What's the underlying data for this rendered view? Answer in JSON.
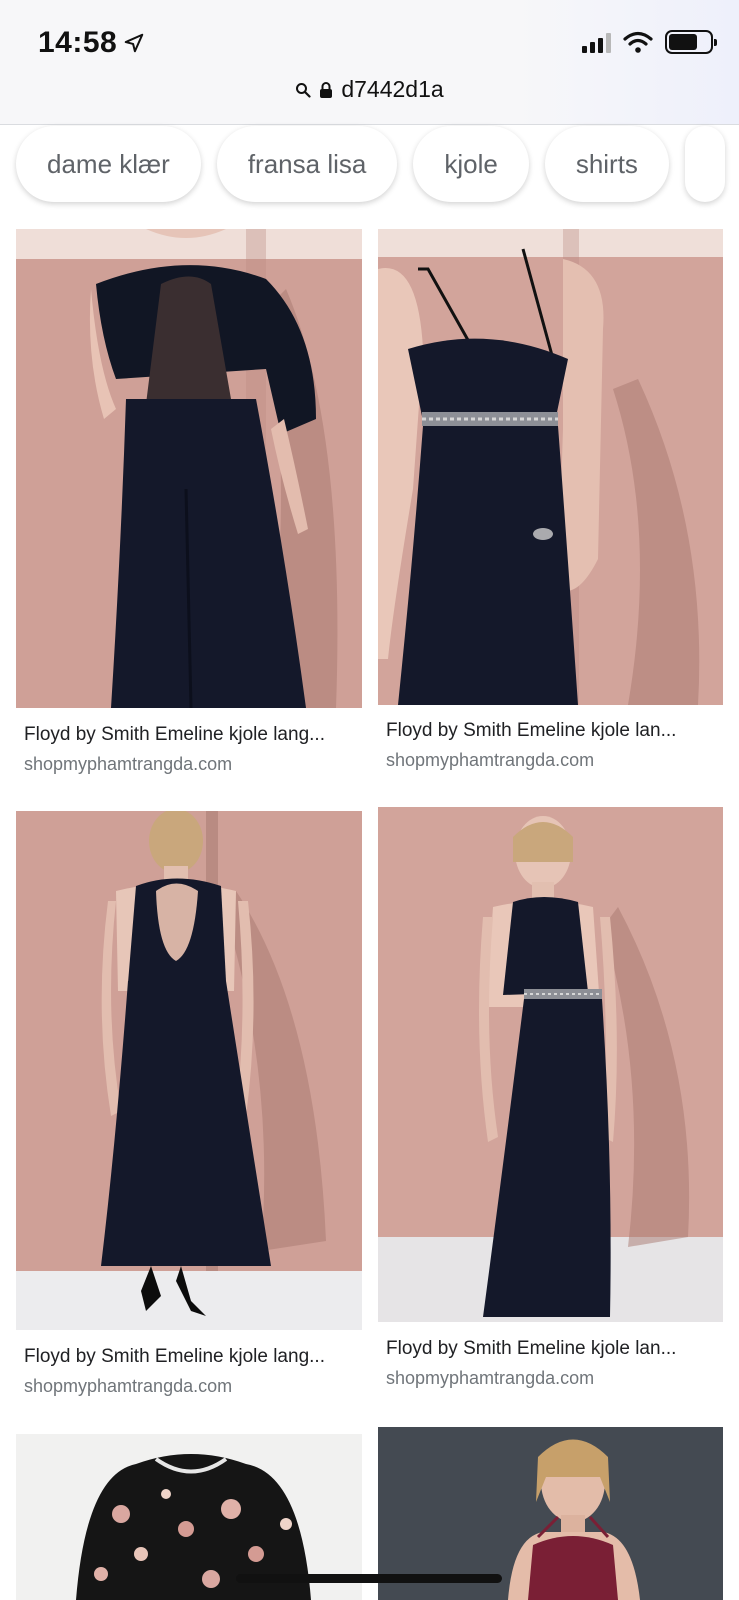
{
  "status_bar": {
    "time": "14:58"
  },
  "address_bar": {
    "url": "d7442d1a"
  },
  "chips": [
    {
      "label": "dame klær"
    },
    {
      "label": "fransa lisa"
    },
    {
      "label": "kjole"
    },
    {
      "label": "shirts"
    }
  ],
  "results": [
    {
      "title": "Floyd by Smith Emeline kjole lang...",
      "source": "shopmyphamtrangda.com"
    },
    {
      "title": "Floyd by Smith Emeline kjole lan...",
      "source": "shopmyphamtrangda.com"
    },
    {
      "title": "Floyd by Smith Emeline kjole lang...",
      "source": "shopmyphamtrangda.com"
    },
    {
      "title": "Floyd by Smith Emeline kjole lan...",
      "source": "shopmyphamtrangda.com"
    }
  ],
  "colors": {
    "dress": "#14182a",
    "wall": "#d0a198",
    "chip_text": "#5f6368",
    "source_text": "#70757a"
  }
}
